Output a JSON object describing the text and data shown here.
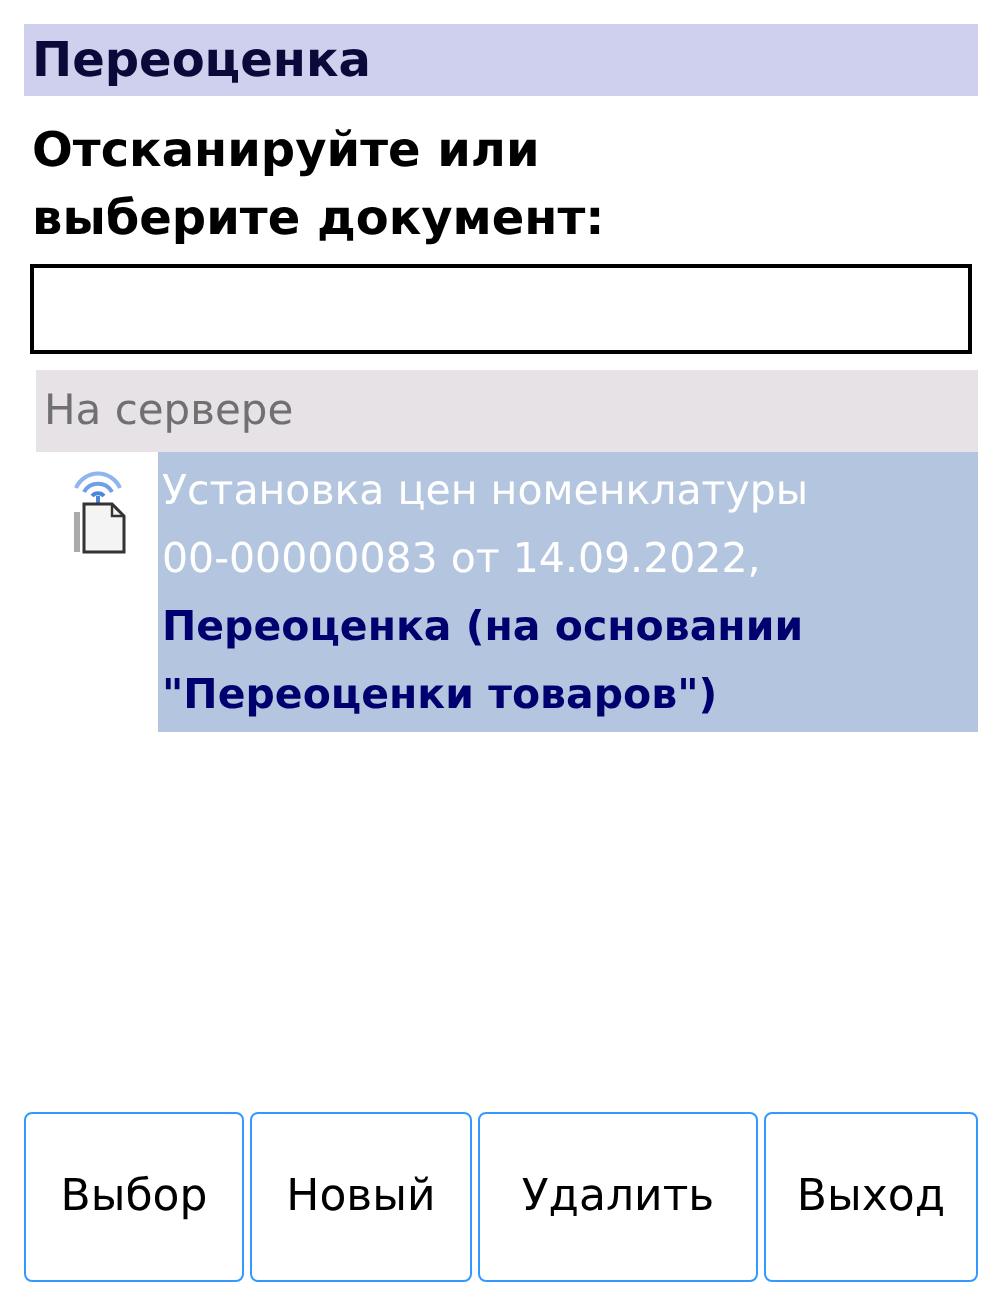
{
  "title": "Переоценка",
  "prompt": "Отсканируйте или выберите документ:",
  "groups": [
    {
      "header": "На сервере",
      "items": [
        {
          "description": "Установка цен номенклатуры 00-00000083 от 14.09.2022,",
          "name": "Переоценка (на основании \"Переоценки товаров\")",
          "selected": true
        }
      ]
    }
  ],
  "buttons": [
    "Выбор",
    "Новый",
    "Удалить",
    "Выход"
  ]
}
